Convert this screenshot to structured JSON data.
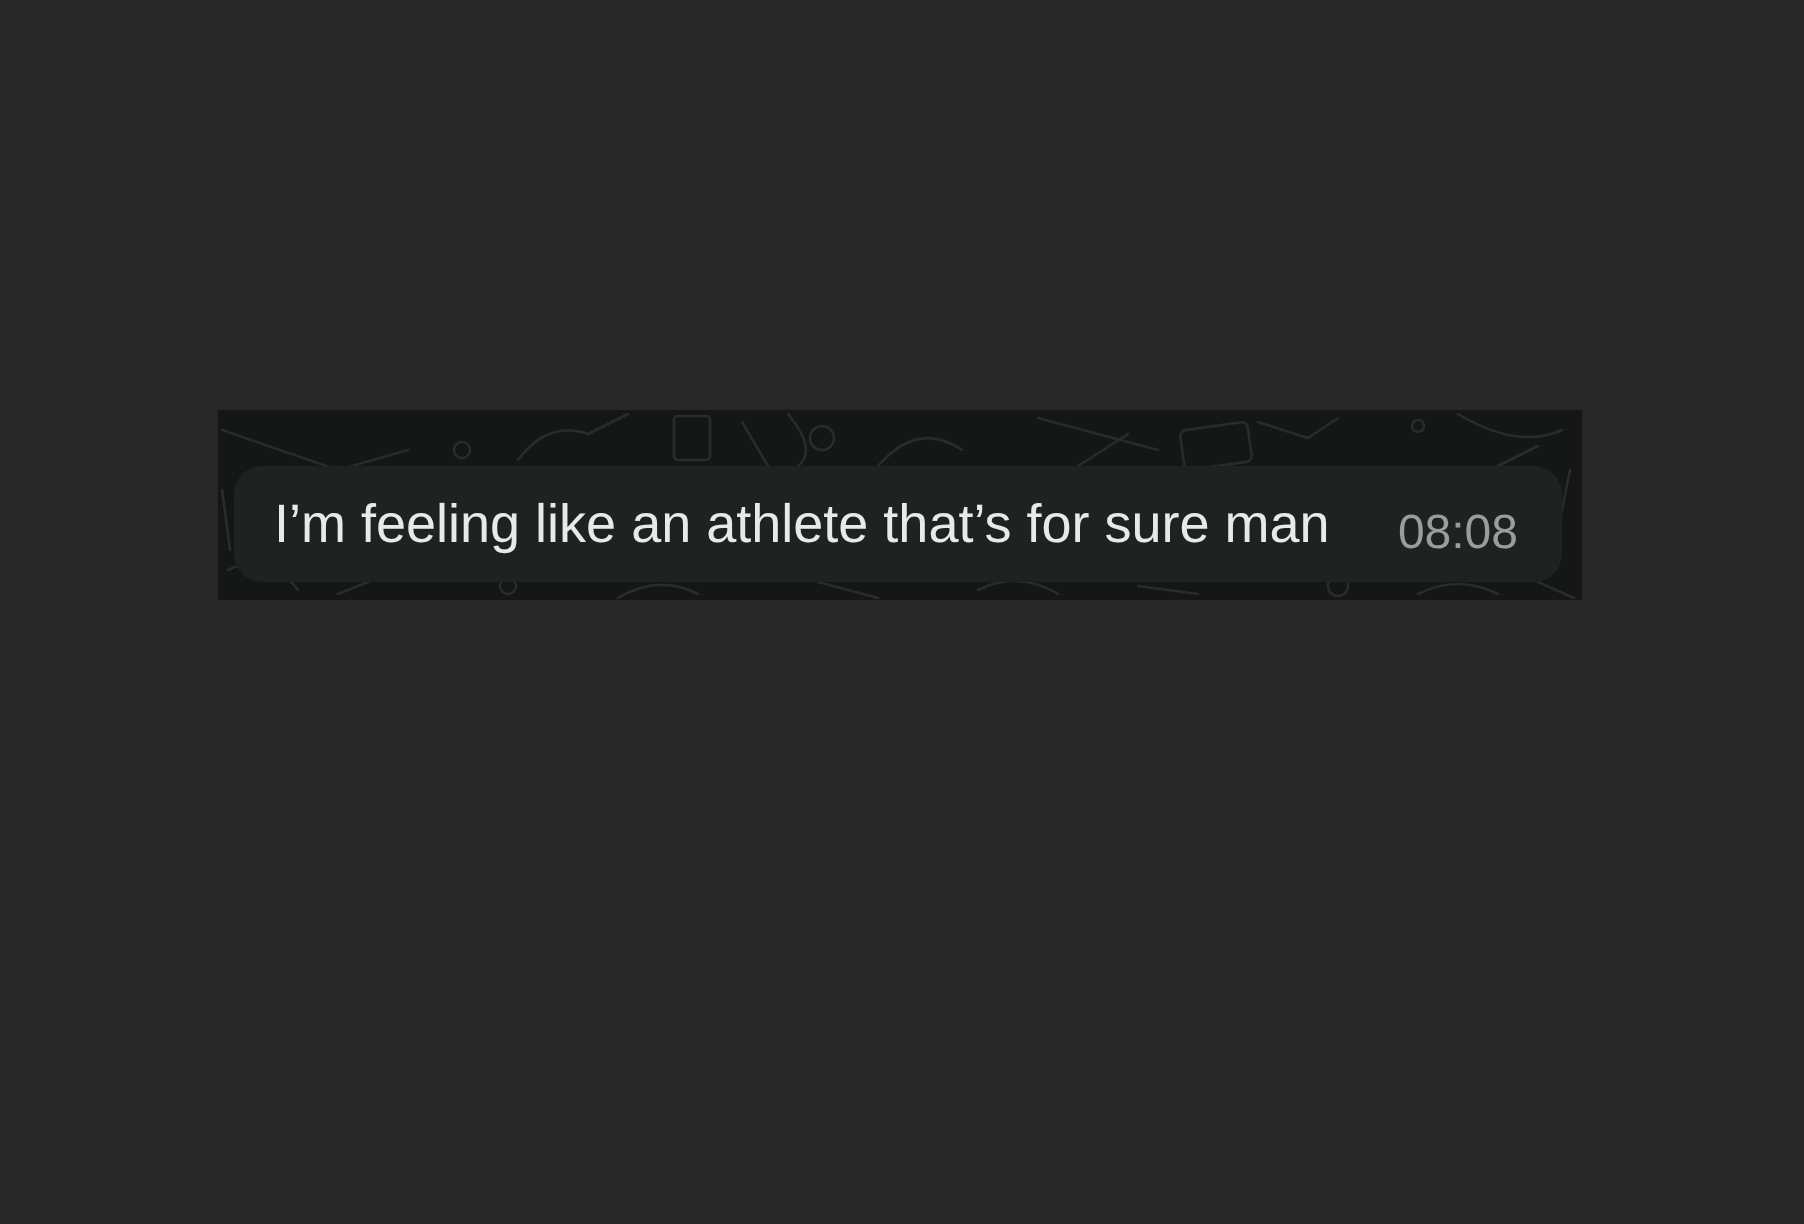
{
  "message": {
    "text": "I’m feeling like an athlete that’s for sure man",
    "time": "08:08"
  }
}
